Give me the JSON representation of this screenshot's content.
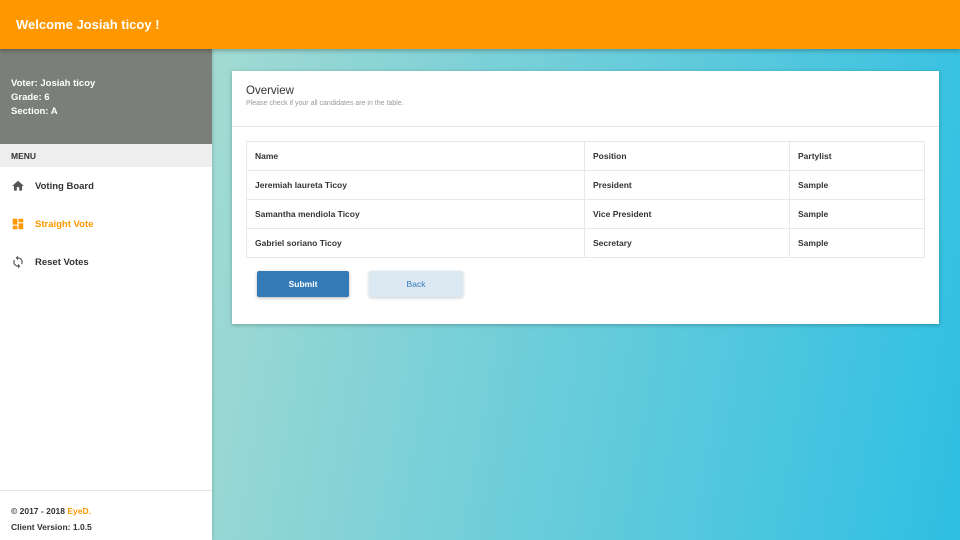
{
  "header": {
    "title": "Welcome Josiah ticoy !"
  },
  "user": {
    "voter": "Voter: Josiah ticoy",
    "grade": "Grade: 6",
    "section": "Section: A"
  },
  "menu": {
    "header": "MENU",
    "items": [
      {
        "label": "Voting Board",
        "icon": "home-icon",
        "active": false
      },
      {
        "label": "Straight Vote",
        "icon": "dashboard-icon",
        "active": true
      },
      {
        "label": "Reset Votes",
        "icon": "refresh-icon",
        "active": false
      }
    ]
  },
  "footer": {
    "copyright": "© 2017 - 2018 ",
    "brand": "EyeD.",
    "version": "Client Version: 1.0.5"
  },
  "overview": {
    "title": "Overview",
    "subtitle": "Please check if your all candidates are in the table.",
    "columns": [
      "Name",
      "Position",
      "Partylist"
    ],
    "rows": [
      [
        "Jeremiah laureta Ticoy",
        "President",
        "Sample"
      ],
      [
        "Samantha mendiola Ticoy",
        "Vice President",
        "Sample"
      ],
      [
        "Gabriel soriano Ticoy",
        "Secretary",
        "Sample"
      ]
    ],
    "submit_label": "Submit",
    "back_label": "Back"
  },
  "colors": {
    "accent": "#ff9800",
    "primary": "#337ab7",
    "user_panel": "#7b7f79"
  }
}
